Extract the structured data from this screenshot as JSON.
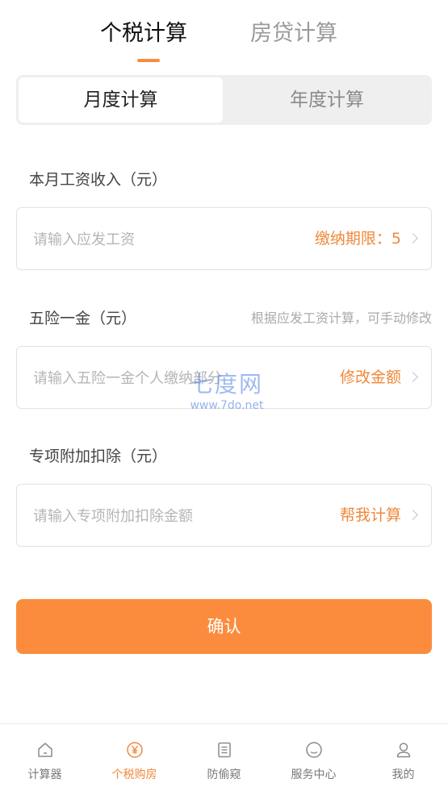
{
  "top_tabs": {
    "tax": "个税计算",
    "mortgage": "房贷计算"
  },
  "segment": {
    "monthly": "月度计算",
    "yearly": "年度计算"
  },
  "salary": {
    "label": "本月工资收入（元）",
    "placeholder": "请输入应发工资",
    "action": "缴纳期限：5"
  },
  "insurance": {
    "label": "五险一金（元）",
    "hint": "根据应发工资计算，可手动修改",
    "placeholder": "请输入五险一金个人缴纳部分",
    "action": "修改金额"
  },
  "deduction": {
    "label": "专项附加扣除（元）",
    "placeholder": "请输入专项附加扣除金额",
    "action": "帮我计算"
  },
  "confirm_label": "确认",
  "watermark": {
    "big": "七度网",
    "small": "www.7do.net"
  },
  "bottom_nav": [
    {
      "label": "计算器",
      "icon": "home-icon"
    },
    {
      "label": "个税购房",
      "icon": "yuan-circle-icon"
    },
    {
      "label": "防偷窥",
      "icon": "document-icon"
    },
    {
      "label": "服务中心",
      "icon": "chat-bubble-icon"
    },
    {
      "label": "我的",
      "icon": "user-icon"
    }
  ],
  "colors": {
    "accent": "#fb8c3e",
    "active_text": "#f0883a",
    "inactive_text": "#9a9a9a"
  }
}
